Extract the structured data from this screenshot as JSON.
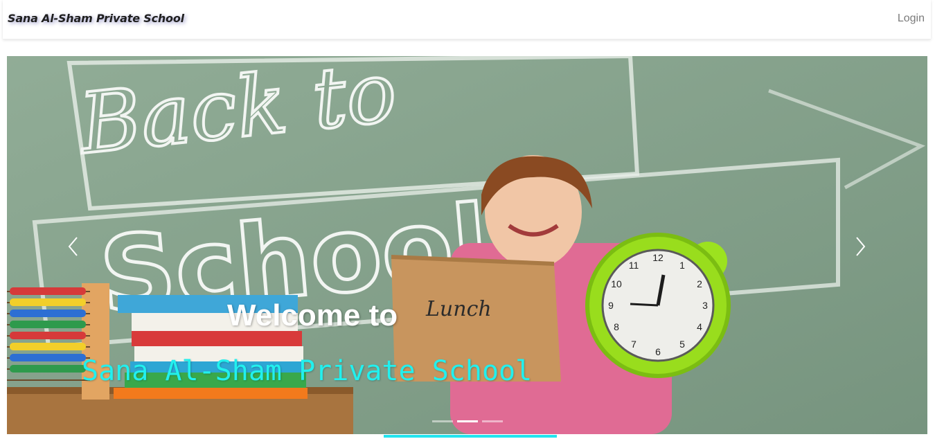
{
  "navbar": {
    "brand": "Sana Al-Sham Private School",
    "login_label": "Login"
  },
  "carousel": {
    "prev_icon": "chevron-left-icon",
    "next_icon": "chevron-right-icon",
    "caption_title": "Welcome to",
    "caption_subtitle": "Sana Al-Sham Private School",
    "indicator_count": 3,
    "active_indicator": 2,
    "scene_text": {
      "chalkboard_line1": "Back to",
      "chalkboard_line2": "School",
      "bag_label": "Lunch",
      "clock_numbers": [
        "12",
        "1",
        "2",
        "3",
        "4",
        "5",
        "6",
        "7",
        "8",
        "9",
        "10",
        "11"
      ]
    }
  },
  "colors": {
    "brand_text": "#1f1f1f",
    "login_text": "#7a7a7a",
    "caption_title": "#ffffff",
    "caption_subtitle": "#22f0ee",
    "accent_bar": "#22e4ee",
    "chalkboard": "#7f9c86"
  }
}
